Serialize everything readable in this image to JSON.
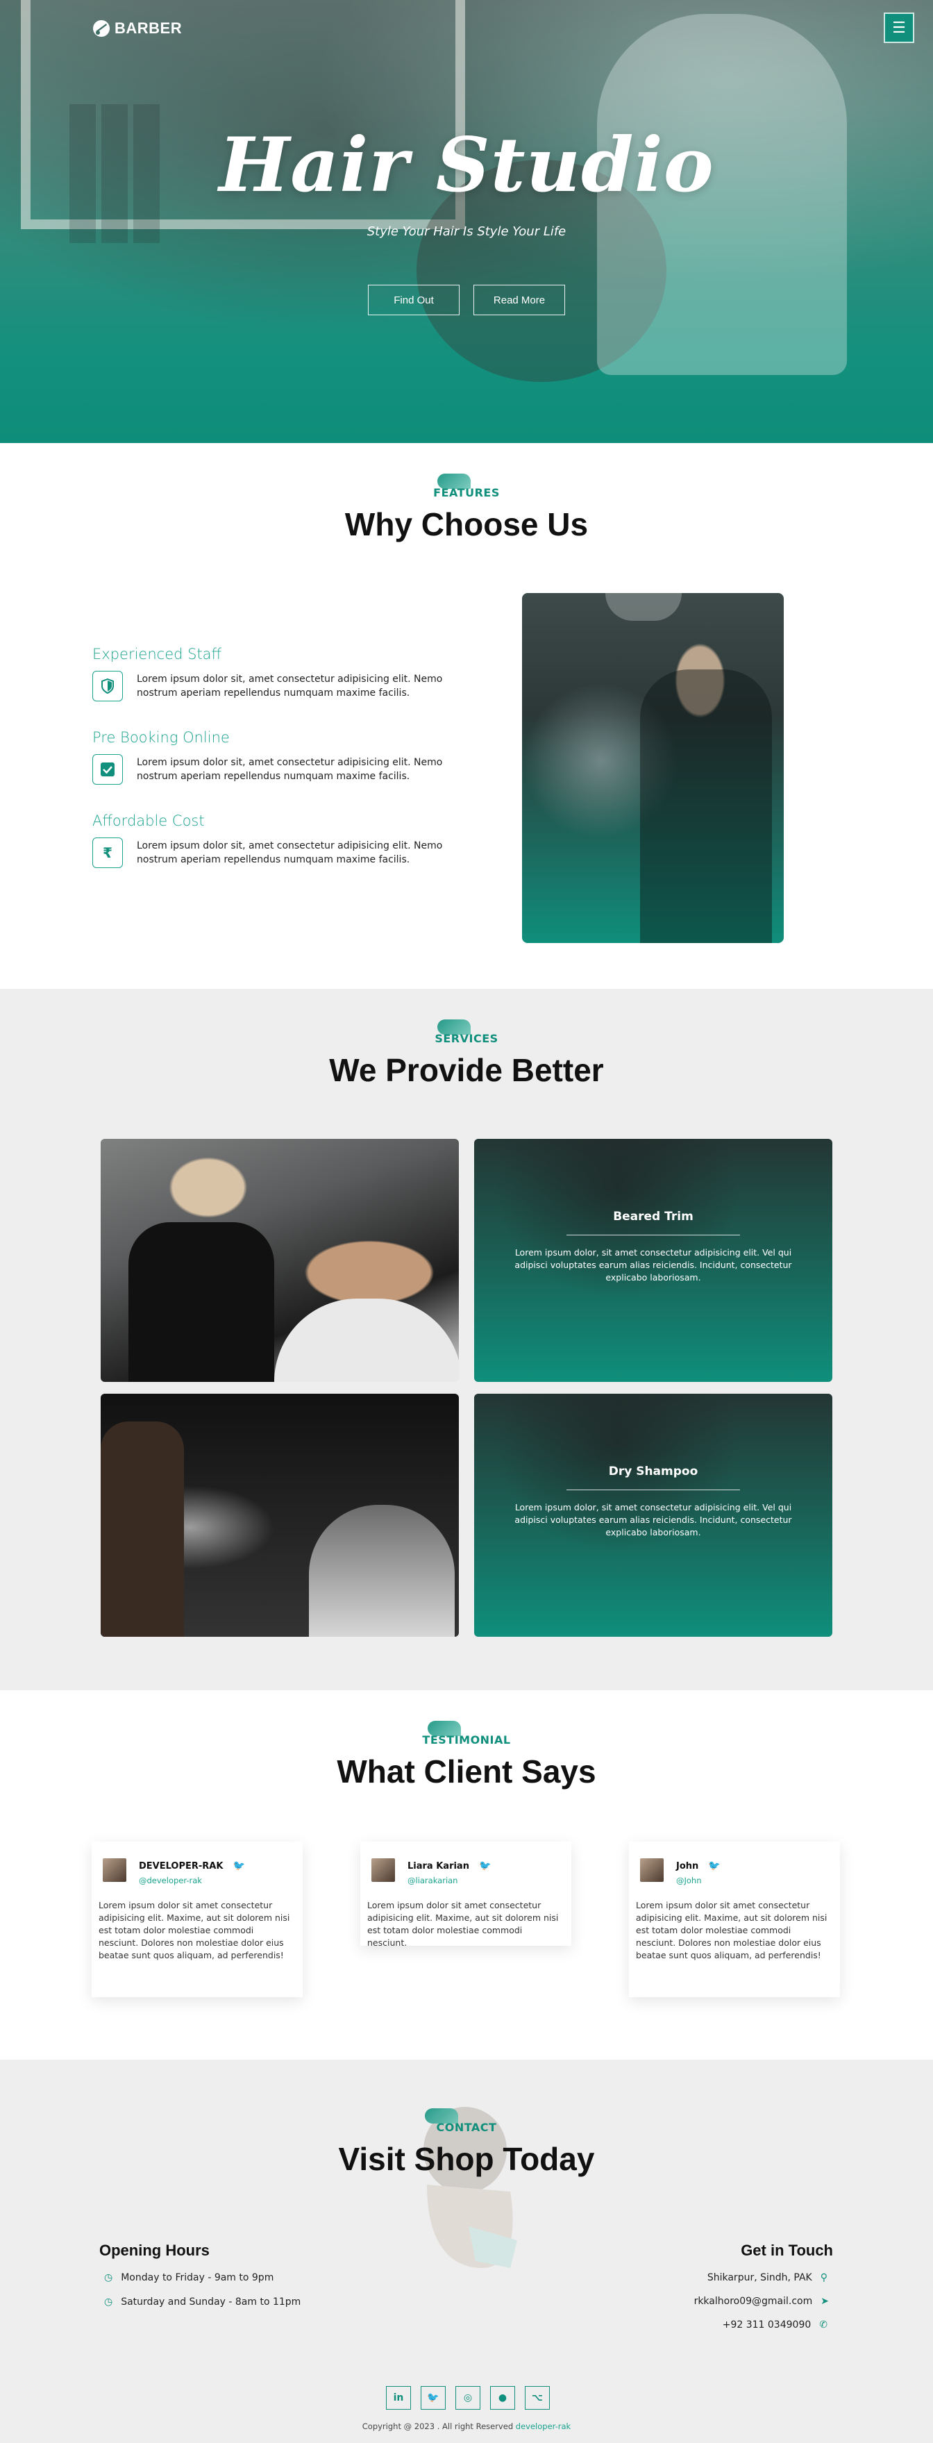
{
  "brand": {
    "name": "BARBER",
    "accent": "#0f8f7c"
  },
  "hero": {
    "title": "Hair Studio",
    "subtitle": "Style Your Hair Is Style Your Life",
    "buttons": [
      "Find Out",
      "Read More"
    ]
  },
  "features": {
    "tag": "FEATURES",
    "title": "Why Choose Us",
    "items": [
      {
        "title": "Experienced Staff",
        "icon": "shield-icon",
        "text": "Lorem ipsum dolor sit, amet consectetur adipisicing elit. Nemo nostrum aperiam repellendus numquam maxime facilis."
      },
      {
        "title": "Pre Booking Online",
        "icon": "check-box-icon",
        "text": "Lorem ipsum dolor sit, amet consectetur adipisicing elit. Nemo nostrum aperiam repellendus numquam maxime facilis."
      },
      {
        "title": "Affordable Cost",
        "icon": "rupee-icon",
        "text": "Lorem ipsum dolor sit, amet consectetur adipisicing elit. Nemo nostrum aperiam repellendus numquam maxime facilis."
      }
    ]
  },
  "services": {
    "tag": "SERVICES",
    "title": "We Provide Better",
    "items": [
      {
        "title": "Beared Trim",
        "text": "Lorem ipsum dolor, sit amet consectetur adipisicing elit. Vel qui adipisci voluptates earum alias reiciendis. Incidunt, consectetur explicabo laboriosam."
      },
      {
        "title": "Dry Shampoo",
        "text": "Lorem ipsum dolor, sit amet consectetur adipisicing elit. Vel qui adipisci voluptates earum alias reiciendis. Incidunt, consectetur explicabo laboriosam."
      }
    ]
  },
  "testimonials": {
    "tag": "TESTIMONIAL",
    "title": "What Client Says",
    "items": [
      {
        "name": "DEVELOPER-RAK",
        "handle": "@developer-rak",
        "text": "Lorem ipsum dolor sit amet consectetur adipisicing elit. Maxime, aut sit dolorem nisi est totam dolor molestiae commodi nesciunt. Dolores non molestiae dolor eius beatae sunt quos aliquam, ad perferendis!"
      },
      {
        "name": "Liara Karian",
        "handle": "@liarakarian",
        "text": "Lorem ipsum dolor sit amet consectetur adipisicing elit. Maxime, aut sit dolorem nisi est totam dolor molestiae commodi nesciunt."
      },
      {
        "name": "John",
        "handle": "@John",
        "text": "Lorem ipsum dolor sit amet consectetur adipisicing elit. Maxime, aut sit dolorem nisi est totam dolor molestiae commodi nesciunt. Dolores non molestiae dolor eius beatae sunt quos aliquam, ad perferendis!"
      }
    ]
  },
  "contact": {
    "tag": "CONTACT",
    "title": "Visit Shop Today",
    "hours_title": "Opening Hours",
    "hours": [
      "Monday to Friday - 9am to 9pm",
      "Saturday and Sunday - 8am to 11pm"
    ],
    "touch_title": "Get in Touch",
    "address": "Shikarpur, Sindh, PAK",
    "email": "rkkalhoro09@gmail.com",
    "phone": "+92 311 0349090",
    "socials": [
      "linkedin-icon",
      "twitter-icon",
      "instagram-icon",
      "blog-icon",
      "github-icon"
    ]
  },
  "footer": {
    "copyright": "Copyright @ 2023 . All right Reserved",
    "author": "developer-rak"
  }
}
